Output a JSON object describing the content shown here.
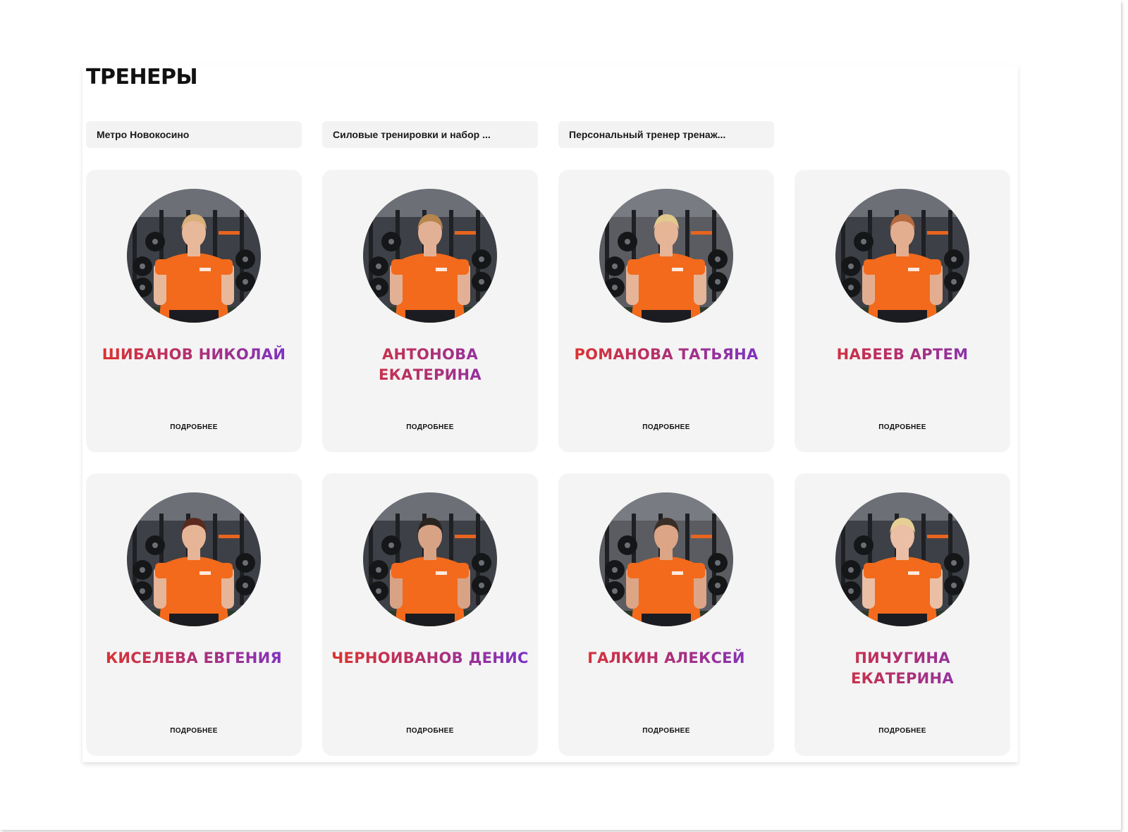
{
  "page": {
    "title": "ТРЕНЕРЫ"
  },
  "filters": [
    {
      "label": "Метро Новокосино"
    },
    {
      "label": "Силовые тренировки и набор ..."
    },
    {
      "label": "Персональный тренер тренаж..."
    }
  ],
  "trainers": [
    {
      "name": "ШИБАНОВ НИКОЛАЙ",
      "link_label": "ПОДРОБНЕЕ",
      "skin": "#e8b89a",
      "hair": "#d9b07a",
      "shirt": "#f36a1c"
    },
    {
      "name": "АНТОНОВА ЕКАТЕРИНА",
      "link_label": "ПОДРОБНЕЕ",
      "skin": "#e2b195",
      "hair": "#b7864f",
      "shirt": "#f36a1c"
    },
    {
      "name": "РОМАНОВА ТАТЬЯНА",
      "link_label": "ПОДРОБНЕЕ",
      "skin": "#e6b497",
      "hair": "#e2c98c",
      "shirt": "#f36a1c"
    },
    {
      "name": "НАБЕЕВ АРТЕМ",
      "link_label": "ПОДРОБНЕЕ",
      "skin": "#e3ae90",
      "hair": "#b56a3e",
      "shirt": "#f36a1c"
    },
    {
      "name": "КИСЕЛЕВА ЕВГЕНИЯ",
      "link_label": "ПОДРОБНЕЕ",
      "skin": "#e6b497",
      "hair": "#5a2a1f",
      "shirt": "#f36a1c"
    },
    {
      "name": "ЧЕРНОИВАНОВ ДЕНИС",
      "link_label": "ПОДРОБНЕЕ",
      "skin": "#d8a285",
      "hair": "#2a2420",
      "shirt": "#f36a1c"
    },
    {
      "name": "ГАЛКИН АЛЕКСЕЙ",
      "link_label": "ПОДРОБНЕЕ",
      "skin": "#dca586",
      "hair": "#3a2e26",
      "shirt": "#f36a1c"
    },
    {
      "name": "ПИЧУГИНА ЕКАТЕРИНА",
      "link_label": "ПОДРОБНЕЕ",
      "skin": "#ebbfa5",
      "hair": "#e6cf93",
      "shirt": "#f36a1c"
    }
  ],
  "colors": {
    "name_gradient_start": "#e0322a",
    "name_gradient_end": "#7a32c9",
    "card_background": "#f4f4f4",
    "filter_background": "#f3f3f3",
    "brand_orange": "#f36a1c"
  },
  "icons": {
    "trainer_photo": "trainer-photo"
  }
}
